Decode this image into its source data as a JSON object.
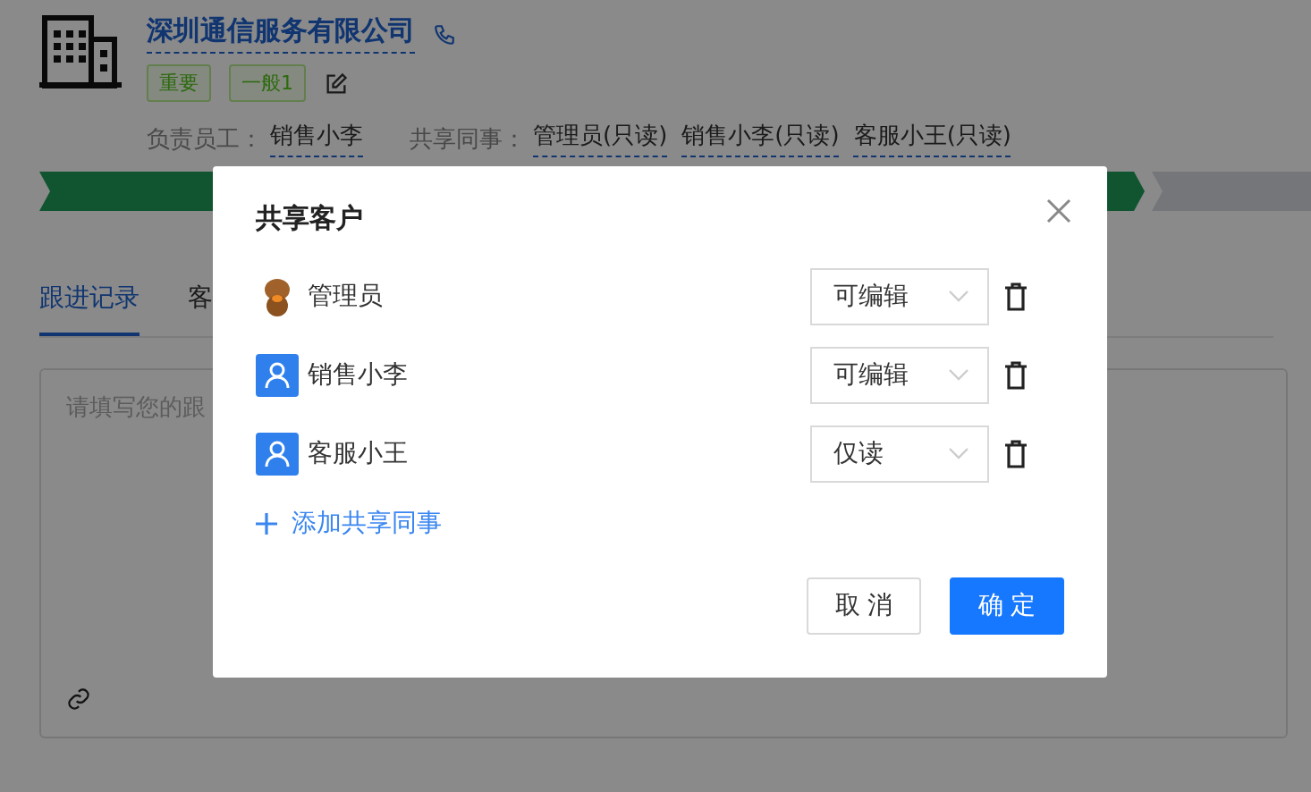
{
  "company": {
    "name": "深圳通信服务有限公司"
  },
  "tags": [
    {
      "label": "重要"
    },
    {
      "label": "一般1"
    }
  ],
  "owner": {
    "label": "负责员工：",
    "value": "销售小李"
  },
  "shared": {
    "label": "共享同事：",
    "values": [
      "管理员(只读)",
      "销售小李(只读)",
      "客服小王(只读)"
    ]
  },
  "tabs": [
    {
      "label": "跟进记录",
      "selected": true
    },
    {
      "label": "客",
      "selected": false
    }
  ],
  "note": {
    "placeholder": "请填写您的跟"
  },
  "dialog": {
    "title": "共享客户",
    "members": [
      {
        "name": "管理员",
        "kind": "figure",
        "permission": "可编辑"
      },
      {
        "name": "销售小李",
        "kind": "default",
        "permission": "可编辑"
      },
      {
        "name": "客服小王",
        "kind": "default",
        "permission": "仅读"
      }
    ],
    "add_label": "添加共享同事",
    "cancel": "取 消",
    "ok": "确 定"
  }
}
